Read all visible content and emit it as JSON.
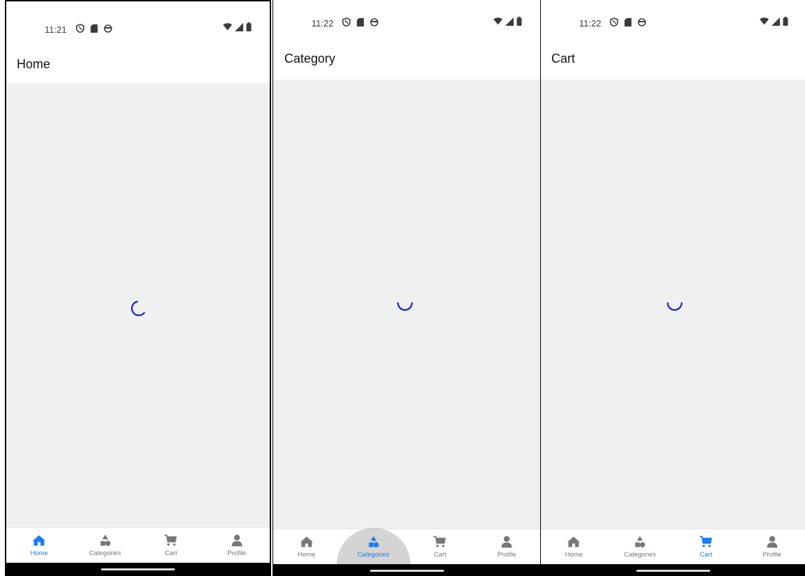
{
  "colors": {
    "accent": "#1e7cf2",
    "inactive": "#777777",
    "spinner": "#1a1adb",
    "background": "#f0f0f0"
  },
  "screens": [
    {
      "status": {
        "time": "11:21"
      },
      "header": {
        "title": "Home"
      },
      "tabs": [
        {
          "label": "Home",
          "icon": "home-icon",
          "active": true
        },
        {
          "label": "Categories",
          "icon": "shapes-icon",
          "active": false
        },
        {
          "label": "Cart",
          "icon": "cart-icon",
          "active": false
        },
        {
          "label": "Profile",
          "icon": "user-icon",
          "active": false
        }
      ]
    },
    {
      "status": {
        "time": "11:22"
      },
      "header": {
        "title": "Category"
      },
      "tabs": [
        {
          "label": "Home",
          "icon": "home-icon",
          "active": false
        },
        {
          "label": "Categories",
          "icon": "shapes-icon",
          "active": true
        },
        {
          "label": "Cart",
          "icon": "cart-icon",
          "active": false
        },
        {
          "label": "Profile",
          "icon": "user-icon",
          "active": false
        }
      ]
    },
    {
      "status": {
        "time": "11:22"
      },
      "header": {
        "title": "Cart"
      },
      "tabs": [
        {
          "label": "Home",
          "icon": "home-icon",
          "active": false
        },
        {
          "label": "Categories",
          "icon": "shapes-icon",
          "active": false
        },
        {
          "label": "Cart",
          "icon": "cart-icon",
          "active": true
        },
        {
          "label": "Profile",
          "icon": "user-icon",
          "active": false
        }
      ]
    }
  ]
}
